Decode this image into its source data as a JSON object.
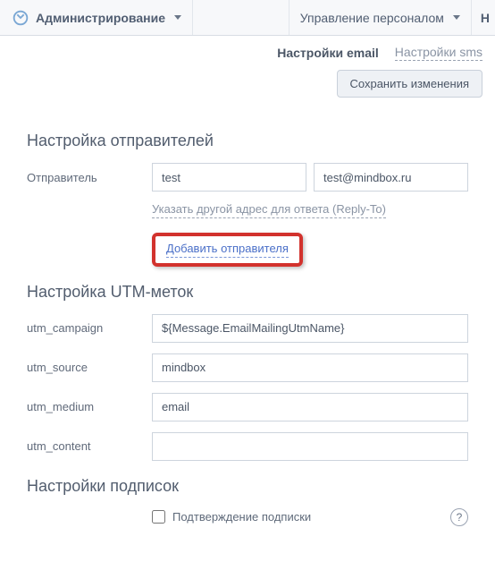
{
  "topbar": {
    "admin_label": "Администрирование",
    "hr_label": "Управление персоналом",
    "truncated_right": "Н"
  },
  "tabs": {
    "email_label": "Настройки email",
    "sms_label": "Настройки sms"
  },
  "buttons": {
    "save_label": "Сохранить изменения"
  },
  "senders": {
    "heading": "Настройка отправителей",
    "row_label": "Отправитель",
    "name_value": "test",
    "email_value": "test@mindbox.ru",
    "reply_to_hint": "Указать другой адрес для ответа (Reply-To)",
    "add_link": "Добавить отправителя"
  },
  "utm": {
    "heading": "Настройка UTM-меток",
    "campaign_label": "utm_campaign",
    "campaign_value": "${Message.EmailMailingUtmName}",
    "source_label": "utm_source",
    "source_value": "mindbox",
    "medium_label": "utm_medium",
    "medium_value": "email",
    "content_label": "utm_content",
    "content_value": ""
  },
  "subscriptions": {
    "heading": "Настройки подписок",
    "confirm_label": "Подтверждение подписки",
    "confirm_checked": false,
    "help_char": "?"
  }
}
